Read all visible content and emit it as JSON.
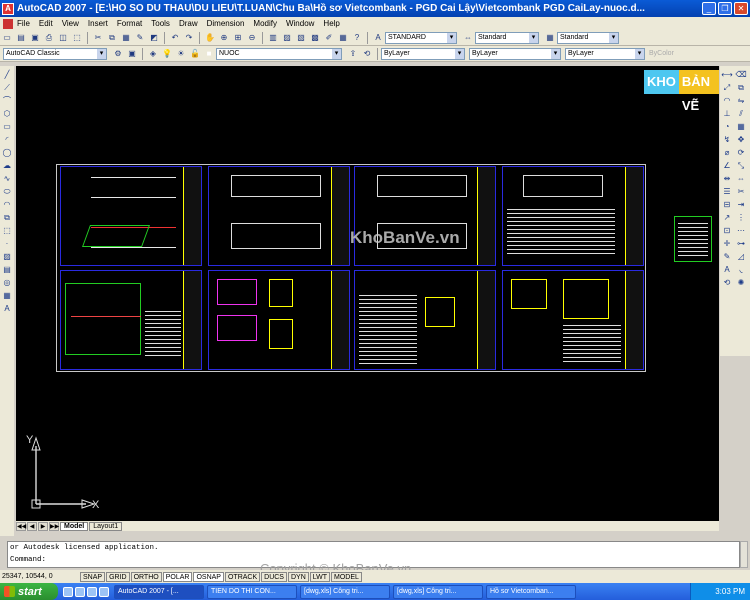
{
  "window": {
    "title": "AutoCAD 2007 - [E:\\HO SO DU THAU\\DU LIEU\\T.LUAN\\Chu Ba\\Hồ sơ Vietcombank - PGD Cai Lậy\\Vietcombank PGD CaiLay-nuoc.d...",
    "minimize_glyph": "_",
    "restore_glyph": "❐",
    "close_glyph": "✕"
  },
  "menu": [
    "File",
    "Edit",
    "View",
    "Insert",
    "Format",
    "Tools",
    "Draw",
    "Dimension",
    "Modify",
    "Window",
    "Help"
  ],
  "toolbar1": {
    "text_style": "STANDARD",
    "dim_style": "Standard",
    "table_style": "Standard"
  },
  "toolbar2": {
    "workspace": "AutoCAD Classic",
    "layer": "NUOC",
    "color": "ByLayer",
    "linetype": "ByLayer",
    "lineweight": "ByLayer",
    "plot_style": "ByColor"
  },
  "canvas": {
    "watermark_mid": "KhoBanVe.vn",
    "logo_left": "KHO",
    "logo_right": "BẢN VẼ",
    "ucs_y": "Y",
    "ucs_x": "X",
    "background": "#000000",
    "sheet_border_color": "#c8c8c8",
    "titleblock_color": "#ffff00",
    "frame_color": "#2a2ae0"
  },
  "tabs": {
    "nav": [
      "◀◀",
      "◀",
      "▶",
      "▶▶"
    ],
    "items": [
      "Model",
      "Layout1"
    ]
  },
  "command": {
    "line1": "or Autodesk licensed application.",
    "line2": "Command:"
  },
  "status": {
    "coords": "25347, 10544, 0",
    "toggles": [
      "SNAP",
      "GRID",
      "ORTHO",
      "POLAR",
      "OSNAP",
      "OTRACK",
      "DUCS",
      "DYN",
      "LWT",
      "MODEL"
    ]
  },
  "copyright": "Copyright © KhoBanVe.vn",
  "taskbar": {
    "start": "start",
    "tasks": [
      "AutoCAD 2007 - [...",
      "TIEN DO THI CON...",
      "[dwg,xls] Công tri...",
      "[dwg,xls] Công tri...",
      "Hồ sơ Vietcomban..."
    ],
    "clock": "3:03 PM"
  }
}
